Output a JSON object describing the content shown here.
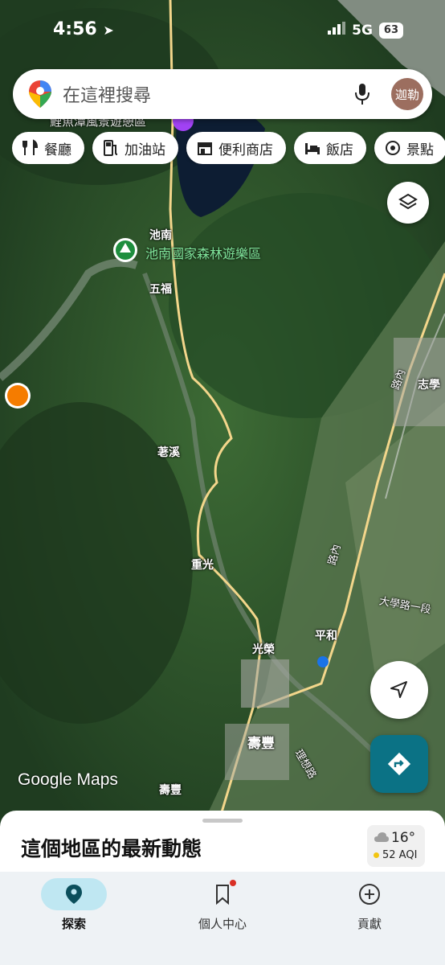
{
  "status_bar": {
    "time": "4:56",
    "network": "5G",
    "battery": "63"
  },
  "search": {
    "placeholder": "在這裡搜尋",
    "avatar_text": "迦勒"
  },
  "chips": [
    {
      "icon": "restaurant-icon",
      "label": "餐廳"
    },
    {
      "icon": "gas-station-icon",
      "label": "加油站"
    },
    {
      "icon": "convenience-store-icon",
      "label": "便利商店"
    },
    {
      "icon": "hotel-icon",
      "label": "飯店"
    },
    {
      "icon": "attraction-icon",
      "label": "景點"
    }
  ],
  "map": {
    "labels": {
      "scenic_area_partial": "鯉魚潭風景遊憩區",
      "chinan": "池南",
      "chinan_forest": "池南國家森林遊樂區",
      "wufu": "五福",
      "laoxi": "荖溪",
      "chongguang": "重光",
      "guangrong": "光榮",
      "pinghe": "平和",
      "shoufeng": "壽豐",
      "shoufeng_small": "壽豐",
      "zhixue": "志學",
      "daxue_road": "大學路一段",
      "lixiang_road": "理想路",
      "road_nei_1": "路內",
      "road_nei_2": "路內"
    },
    "attribution": "Google Maps"
  },
  "bottom_sheet": {
    "title": "這個地區的最新動態",
    "weather": {
      "temp": "16°",
      "aqi": "52 AQI"
    }
  },
  "nav": [
    {
      "icon": "explore-pin-icon",
      "label": "探索",
      "active": true
    },
    {
      "icon": "saved-bookmark-icon",
      "label": "個人中心",
      "active": false
    },
    {
      "icon": "contribute-plus-icon",
      "label": "貢獻",
      "active": false
    }
  ],
  "colors": {
    "accent": "#0b7285",
    "nav_active_bg": "#bfe7f2",
    "road": "#f3d68b"
  }
}
